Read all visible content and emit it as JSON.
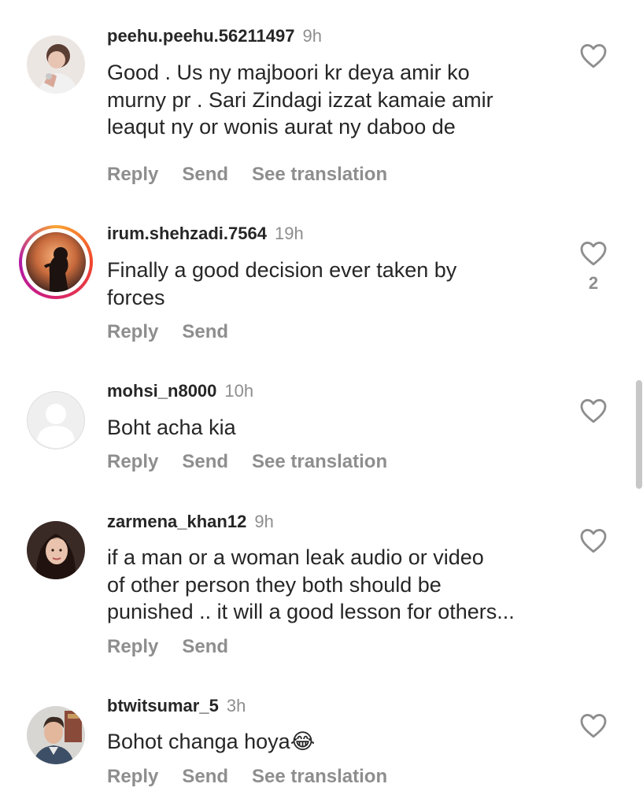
{
  "comments": [
    {
      "username": "peehu.peehu.56211497",
      "time": "9h",
      "text": "Good . Us ny majboori kr deya amir ko\nmurny pr . Sari Zindagi izzat kamaie amir\nleaqut ny or wonis aurat ny daboo de",
      "actions": [
        "Reply",
        "Send",
        "See translation"
      ],
      "likes": ""
    },
    {
      "username": "irum.shehzadi.7564",
      "time": "19h",
      "text": "Finally a good decision ever taken by\nforces",
      "actions": [
        "Reply",
        "Send"
      ],
      "likes": "2"
    },
    {
      "username": "mohsi_n8000",
      "time": "10h",
      "text": "Boht acha kia",
      "actions": [
        "Reply",
        "Send",
        "See translation"
      ],
      "likes": ""
    },
    {
      "username": "zarmena_khan12",
      "time": "9h",
      "text": "if a man or a woman leak audio or video\nof other person they both should be\npunished .. it will a good lesson for others...",
      "actions": [
        "Reply",
        "Send"
      ],
      "likes": ""
    },
    {
      "username": "btwitsumar_5",
      "time": "3h",
      "text": "Bohot changa hoya😂",
      "actions": [
        "Reply",
        "Send",
        "See translation"
      ],
      "likes": ""
    }
  ],
  "icons": {
    "like": "heart-outline-icon"
  },
  "colors": {
    "text": "#262626",
    "muted": "#8e8e8e",
    "story_ring": "#d8236c"
  }
}
